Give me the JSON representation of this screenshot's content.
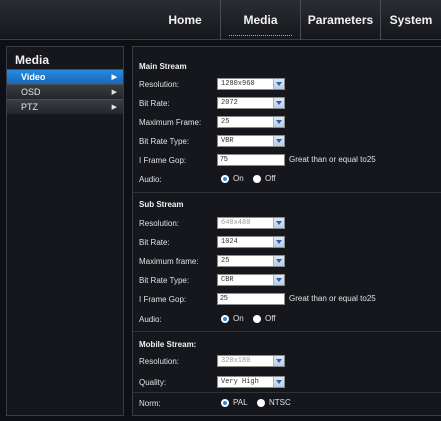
{
  "nav": {
    "tabs": [
      {
        "label": "Home"
      },
      {
        "label": "Media"
      },
      {
        "label": "Parameters"
      },
      {
        "label": "System"
      }
    ],
    "active": "Media"
  },
  "sidebar": {
    "title": "Media",
    "items": [
      {
        "label": "Video",
        "active": true
      },
      {
        "label": "OSD"
      },
      {
        "label": "PTZ"
      }
    ]
  },
  "main_stream": {
    "title": "Main Stream",
    "resolution_label": "Resolution:",
    "resolution": "1280x960",
    "bitrate_label": "Bit Rate:",
    "bitrate": "2072",
    "maxframe_label": "Maximum Frame:",
    "maxframe": "25",
    "bitratetype_label": "Bit Rate Type:",
    "bitratetype": "VBR",
    "gop_label": "I Frame Gop:",
    "gop": "75",
    "gop_hint": "Great than or equal to25",
    "audio_label": "Audio:",
    "on": "On",
    "off": "Off"
  },
  "sub_stream": {
    "title": "Sub Stream",
    "resolution_label": "Resolution:",
    "resolution": "640x480",
    "bitrate_label": "Bit Rate:",
    "bitrate": "1024",
    "maxframe_label": "Maximum frame:",
    "maxframe": "25",
    "bitratetype_label": "Bit Rate Type:",
    "bitratetype": "CBR",
    "gop_label": "I Frame Gop:",
    "gop": "25",
    "gop_hint": "Great than or equal to25",
    "audio_label": "Audio:",
    "on": "On",
    "off": "Off"
  },
  "mobile_stream": {
    "title": "Mobile Stream:",
    "resolution_label": "Resolution:",
    "resolution": "320x180",
    "quality_label": "Quality:",
    "quality": "Very High",
    "norm_label": "Norm:",
    "pal": "PAL",
    "ntsc": "NTSC"
  }
}
